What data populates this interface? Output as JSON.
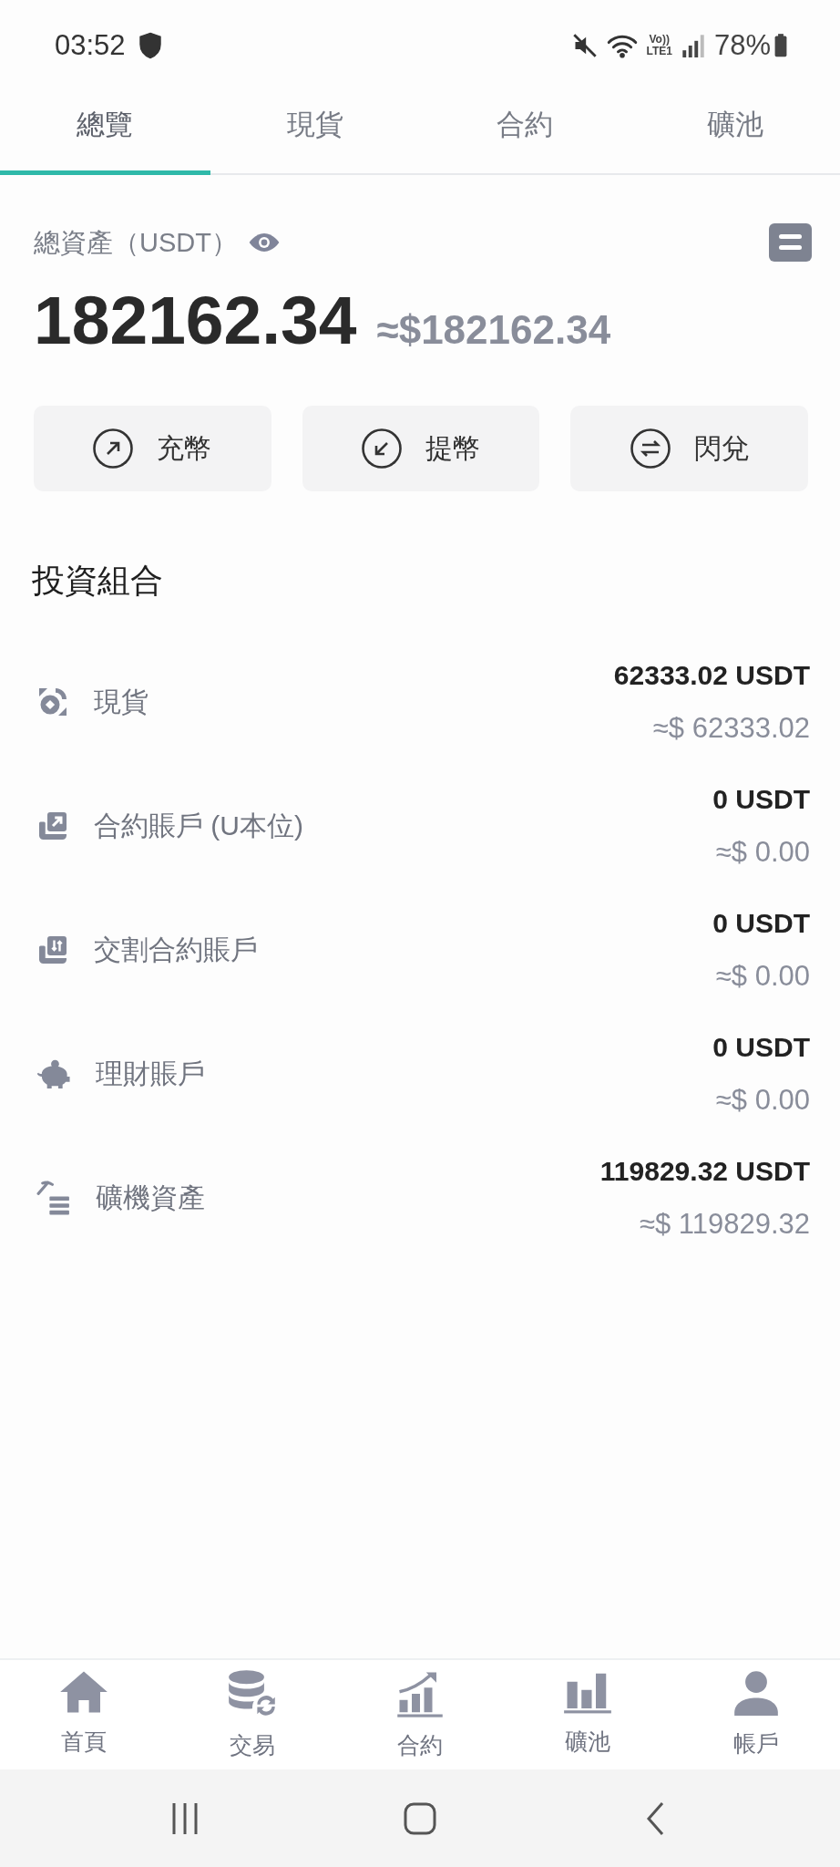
{
  "status_bar": {
    "time": "03:52",
    "volte": "Vo))",
    "network": "LTE1",
    "battery": "78%"
  },
  "tabs": [
    {
      "label": "總覽",
      "selected": true
    },
    {
      "label": "現貨",
      "selected": false
    },
    {
      "label": "合約",
      "selected": false
    },
    {
      "label": "礦池",
      "selected": false
    }
  ],
  "summary": {
    "label": "總資產（USDT）",
    "total": "182162.34",
    "approx": "≈$182162.34"
  },
  "actions": [
    {
      "label": "充幣"
    },
    {
      "label": "提幣"
    },
    {
      "label": "閃兌"
    }
  ],
  "portfolio": {
    "title": "投資組合",
    "items": [
      {
        "name": "現貨",
        "amount": "62333.02 USDT",
        "approx": "≈$ 62333.02"
      },
      {
        "name": "合約賬戶 (U本位)",
        "amount": "0 USDT",
        "approx": "≈$ 0.00"
      },
      {
        "name": "交割合約賬戶",
        "amount": "0 USDT",
        "approx": "≈$ 0.00"
      },
      {
        "name": "理財賬戶",
        "amount": "0 USDT",
        "approx": "≈$ 0.00"
      },
      {
        "name": "礦機資產",
        "amount": "119829.32 USDT",
        "approx": "≈$ 119829.32"
      }
    ]
  },
  "bottom_nav": [
    {
      "label": "首頁",
      "selected": false
    },
    {
      "label": "交易",
      "selected": false
    },
    {
      "label": "合約",
      "selected": false
    },
    {
      "label": "礦池",
      "selected": false
    },
    {
      "label": "帳戶",
      "selected": false
    }
  ]
}
